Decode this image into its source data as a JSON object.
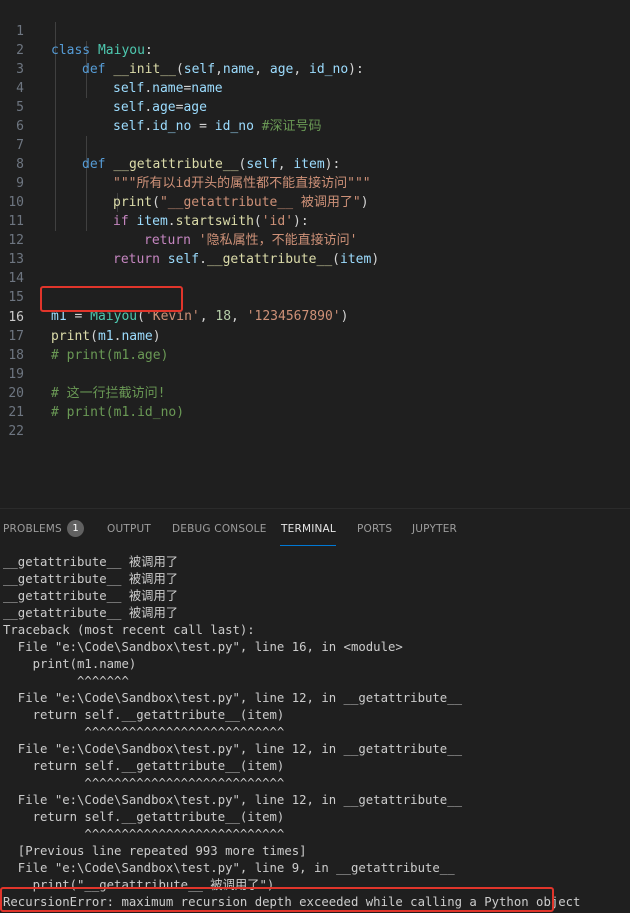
{
  "editor": {
    "active_line": "16",
    "lines": [
      {
        "n": "1"
      },
      {
        "n": "2"
      },
      {
        "n": "3"
      },
      {
        "n": "4"
      },
      {
        "n": "5"
      },
      {
        "n": "6"
      },
      {
        "n": "7"
      },
      {
        "n": "8"
      },
      {
        "n": "9"
      },
      {
        "n": "10"
      },
      {
        "n": "11"
      },
      {
        "n": "12"
      },
      {
        "n": "13"
      },
      {
        "n": "14"
      },
      {
        "n": "15"
      },
      {
        "n": "16"
      },
      {
        "n": "17"
      },
      {
        "n": "18"
      },
      {
        "n": "19"
      },
      {
        "n": "20"
      },
      {
        "n": "21"
      },
      {
        "n": "22"
      }
    ],
    "code": {
      "l1": [
        "class",
        " ",
        "Maiyou",
        ":"
      ],
      "l2": [
        "def",
        " ",
        "__init__",
        "(",
        "self",
        ",",
        "name",
        ", ",
        "age",
        ", ",
        "id_no",
        "):"
      ],
      "l3": [
        "self",
        ".",
        "name",
        "=",
        "name"
      ],
      "l4": [
        "self",
        ".",
        "age",
        "=",
        "age"
      ],
      "l5": [
        "self",
        ".",
        "id_no",
        " = ",
        "id_no",
        " ",
        "#深证号码"
      ],
      "l7": [
        "def",
        " ",
        "__getattribute__",
        "(",
        "self",
        ", ",
        "item",
        "):"
      ],
      "l8": [
        "\"\"\"所有以id开头的属性都不能直接访问\"\"\""
      ],
      "l9": [
        "print",
        "(",
        "\"__getattribute__ 被调用了\"",
        ")"
      ],
      "l10": [
        "if",
        " ",
        "item",
        ".",
        "startswith",
        "(",
        "'id'",
        "):"
      ],
      "l11": [
        "return",
        " ",
        "'隐私属性，不能直接访问'"
      ],
      "l12": [
        "return",
        " ",
        "self",
        ".",
        "__getattribute__",
        "(",
        "item",
        ")"
      ],
      "l15": [
        "m1",
        " = ",
        "Maiyou",
        "(",
        "'Kevin'",
        ", ",
        "18",
        ", ",
        "'1234567890'",
        ")"
      ],
      "l16": [
        "print",
        "(",
        "m1",
        ".",
        "name",
        ")"
      ],
      "l17": [
        "# print(m1.age)"
      ],
      "l19": [
        "# 这一行拦截访问!"
      ],
      "l20": [
        "# print(m1.id_no)"
      ]
    }
  },
  "panel": {
    "tabs": {
      "problems": "PROBLEMS",
      "problems_count": "1",
      "output": "OUTPUT",
      "debug_console": "DEBUG CONSOLE",
      "terminal": "TERMINAL",
      "ports": "PORTS",
      "jupyter": "JUPYTER"
    },
    "active_tab": "TERMINAL"
  },
  "terminal": {
    "lines": [
      "__getattribute__ 被调用了",
      "__getattribute__ 被调用了",
      "__getattribute__ 被调用了",
      "__getattribute__ 被调用了",
      "Traceback (most recent call last):",
      "  File \"e:\\Code\\Sandbox\\test.py\", line 16, in <module>",
      "    print(m1.name)",
      "          ^^^^^^^",
      "",
      "  File \"e:\\Code\\Sandbox\\test.py\", line 12, in __getattribute__",
      "    return self.__getattribute__(item)",
      "           ^^^^^^^^^^^^^^^^^^^^^^^^^^^",
      "",
      "  File \"e:\\Code\\Sandbox\\test.py\", line 12, in __getattribute__",
      "    return self.__getattribute__(item)",
      "           ^^^^^^^^^^^^^^^^^^^^^^^^^^^",
      "",
      "  File \"e:\\Code\\Sandbox\\test.py\", line 12, in __getattribute__",
      "    return self.__getattribute__(item)",
      "           ^^^^^^^^^^^^^^^^^^^^^^^^^^^",
      "",
      "  [Previous line repeated 993 more times]",
      "  File \"e:\\Code\\Sandbox\\test.py\", line 9, in __getattribute__",
      "    print(\"__getattribute__ 被调用了\")",
      "RecursionError: maximum recursion depth exceeded while calling a Python object"
    ]
  },
  "colors": {
    "background": "#1f1f1f",
    "highlight_box": "#e0352b",
    "active_tab_underline": "#0078d4"
  }
}
